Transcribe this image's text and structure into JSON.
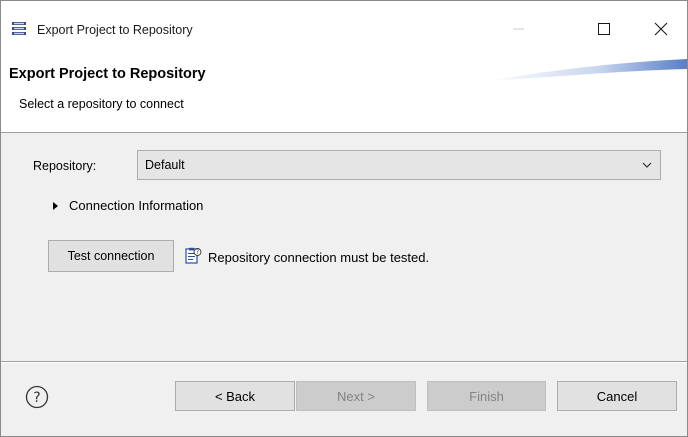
{
  "window": {
    "title": "Export Project to Repository",
    "title_icon": "export-wizard-icon"
  },
  "banner": {
    "title": "Export Project to Repository",
    "subtitle": "Select a repository to connect"
  },
  "form": {
    "repository_label": "Repository:",
    "repository_value": "Default",
    "connection_info_label": "Connection Information",
    "connection_info_expanded": false,
    "test_button_label": "Test connection",
    "test_status_text": "Repository connection must be tested.",
    "test_status_icon": "info-clipboard-icon"
  },
  "footer": {
    "help_icon": "help-icon",
    "back_label": "< Back",
    "next_label": "Next >",
    "finish_label": "Finish",
    "cancel_label": "Cancel",
    "next_enabled": false,
    "finish_enabled": false
  },
  "colors": {
    "background": "#f0f0f0",
    "banner_background": "#ffffff",
    "button_face": "#e1e1e1",
    "disabled_button": "#cccccc",
    "accent_swoosh": "#5a7fc6"
  }
}
